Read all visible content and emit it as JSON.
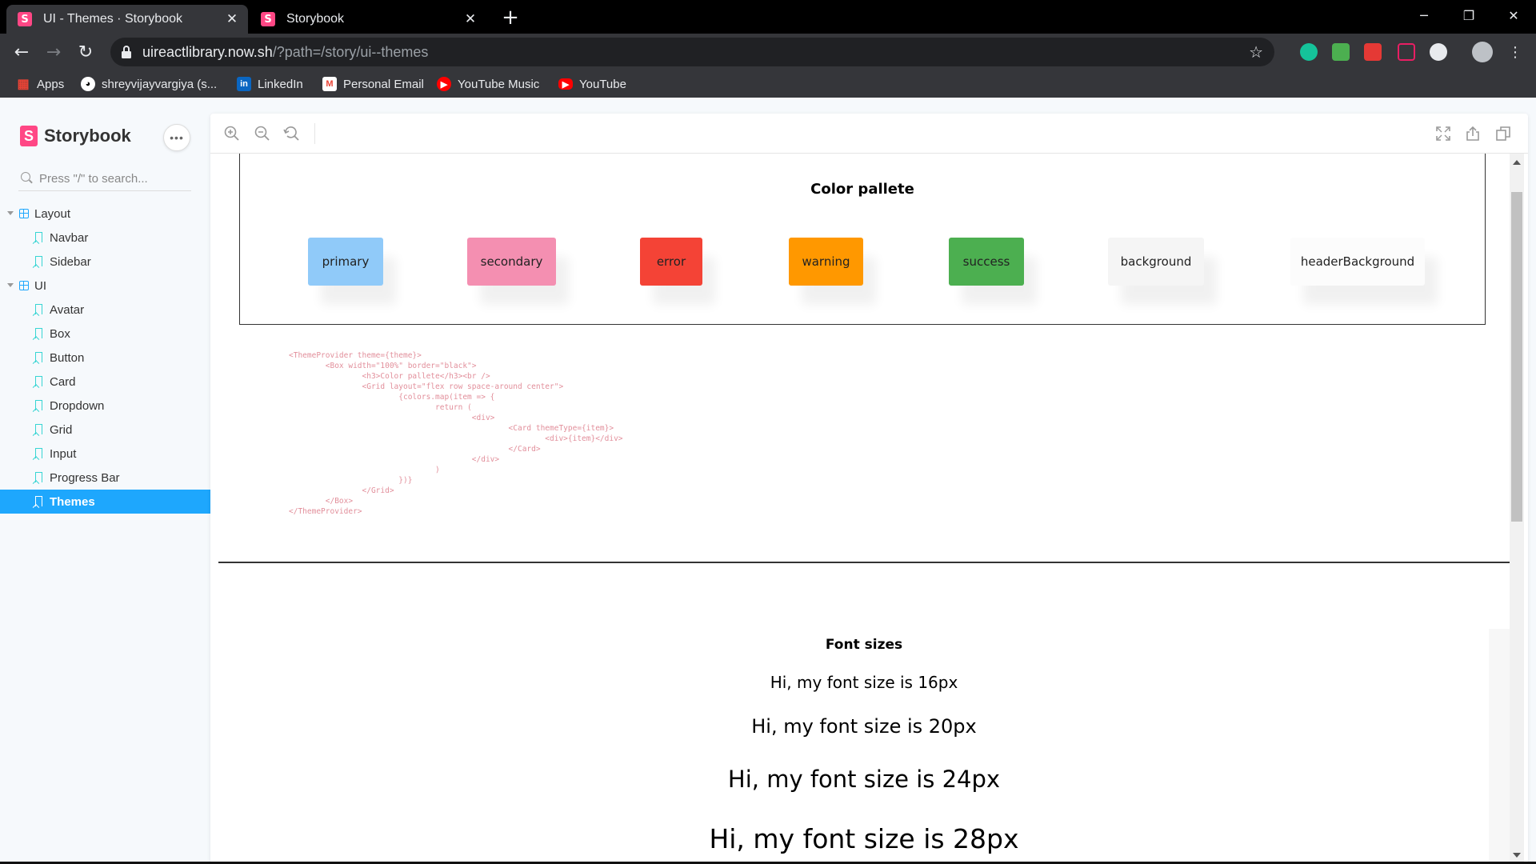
{
  "browser": {
    "tabs": [
      {
        "title": "UI - Themes · Storybook",
        "favicon": "S",
        "active": true
      },
      {
        "title": "Storybook",
        "favicon": "S",
        "active": false
      }
    ],
    "new_tab": "+",
    "url_host": "uireactlibrary.now.sh",
    "url_path": "/?path=/story/ui--themes",
    "bookmarks": [
      {
        "label": "Apps",
        "icon": "apps-grid-icon"
      },
      {
        "label": "shreyvijayvargiya (s...",
        "icon": "github-icon"
      },
      {
        "label": "LinkedIn",
        "icon": "linkedin-icon"
      },
      {
        "label": "Personal Email",
        "icon": "gmail-icon"
      },
      {
        "label": "YouTube Music",
        "icon": "youtube-music-icon"
      },
      {
        "label": "YouTube",
        "icon": "youtube-icon"
      }
    ]
  },
  "sidebar": {
    "brand": "Storybook",
    "menu_label": "•••",
    "search_placeholder": "Press \"/\" to search...",
    "groups": [
      {
        "label": "Layout",
        "items": [
          "Navbar",
          "Sidebar"
        ]
      },
      {
        "label": "UI",
        "items": [
          "Avatar",
          "Box",
          "Button",
          "Card",
          "Dropdown",
          "Grid",
          "Input",
          "Progress Bar",
          "Themes"
        ]
      }
    ],
    "selected": "Themes"
  },
  "preview": {
    "palette": {
      "title": "Color pallete",
      "swatches": [
        {
          "label": "primary",
          "color": "#90caf9"
        },
        {
          "label": "secondary",
          "color": "#f48fb1"
        },
        {
          "label": "error",
          "color": "#f44336"
        },
        {
          "label": "warning",
          "color": "#ff9800"
        },
        {
          "label": "success",
          "color": "#4caf50"
        },
        {
          "label": "background",
          "color": "#f5f5f5"
        },
        {
          "label": "headerBackground",
          "color": "#fcfcfc"
        }
      ]
    },
    "code_lines": [
      "<ThemeProvider theme={theme}>",
      "        <Box width=\"100%\" border=\"black\">",
      "                <h3>Color pallete</h3><br />",
      "                <Grid layout=\"flex row space-around center\">",
      "                        {colors.map(item => {",
      "                                return (",
      "                                        <div>",
      "                                                <Card themeType={item}>",
      "                                                        <div>{item}</div>",
      "                                                </Card>",
      "                                        </div>",
      "                                )",
      "                        })}",
      "                </Grid>",
      "        </Box>",
      "</ThemeProvider>"
    ],
    "font_sizes": {
      "title": "Font sizes",
      "lines": [
        {
          "text": "Hi, my font size is 16px",
          "size": 16
        },
        {
          "text": "Hi, my font size is 20px",
          "size": 20
        },
        {
          "text": "Hi, my font size is 24px",
          "size": 24
        },
        {
          "text": "Hi, my font size is 28px",
          "size": 28
        }
      ]
    }
  }
}
